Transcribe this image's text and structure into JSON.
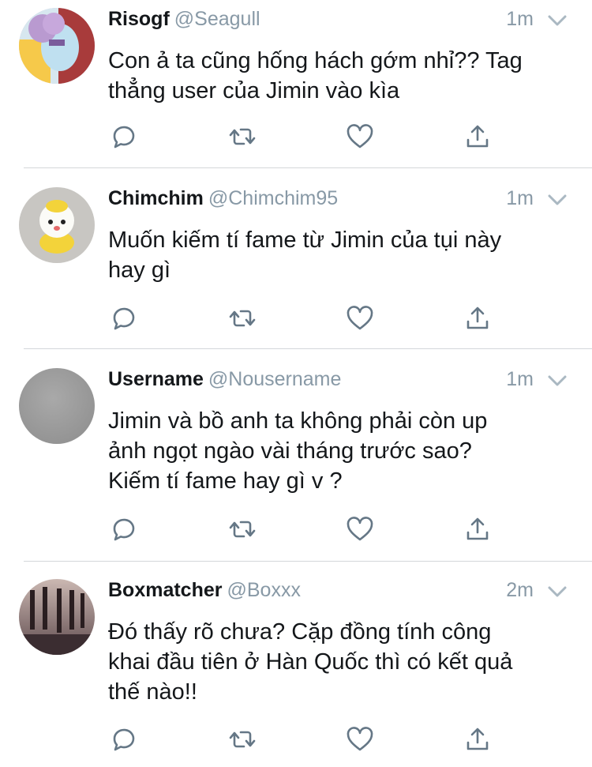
{
  "colors": {
    "text": "#14171a",
    "muted": "#8899a6",
    "icon": "#657786",
    "divider": "#d4d7da"
  },
  "tweets": [
    {
      "name": "Risogf",
      "handle": "@Seagull",
      "time": "1m",
      "lines": [
        "Con ả ta cũng hống hách gớm nhỉ?? Tag",
        "thẳng user của Jimin vào kìa"
      ],
      "avatar": "cartoon-avatar"
    },
    {
      "name": "Chimchim",
      "handle": "@Chimchim95",
      "time": "1m",
      "lines": [
        "Muốn kiếm tí fame từ Jimin của tụi này",
        "hay gì"
      ],
      "avatar": "plush-avatar"
    },
    {
      "name": "Username",
      "handle": "@Nousername",
      "time": "1m",
      "lines": [
        "Jimin và bồ anh ta không phải còn up",
        "ảnh ngọt ngào vài tháng trước sao?",
        "Kiếm tí fame hay gì v ?"
      ],
      "avatar": "blank-avatar"
    },
    {
      "name": "Boxmatcher",
      "handle": "@Boxxx",
      "time": "2m",
      "lines": [
        "Đó thấy rõ chưa? Cặp đồng tính công",
        "khai đầu tiên ở Hàn Quốc thì có kết quả",
        "thế nào!!"
      ],
      "avatar": "photo-avatar"
    }
  ],
  "action_icons": [
    "reply-icon",
    "retweet-icon",
    "like-icon",
    "share-icon"
  ]
}
